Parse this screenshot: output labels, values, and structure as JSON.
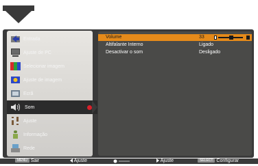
{
  "colors": {
    "osd_background": "#3a3a3a",
    "menu_panel": "#d9d7d3",
    "right_panel": "#4a4a48",
    "highlight": "#e58a1a",
    "selected_item": "#2b2b2b",
    "indicator": "#d8202a"
  },
  "menu": {
    "items": [
      {
        "label": "Entrada",
        "icon": "input-icon"
      },
      {
        "label": "Ajuste de PC",
        "icon": "pc-adjust-icon"
      },
      {
        "label": "Selecionar imagem",
        "icon": "image-select-icon"
      },
      {
        "label": "Ajuste de imagem",
        "icon": "image-adjust-icon"
      },
      {
        "label": "Ecrã",
        "icon": "screen-icon"
      },
      {
        "label": "Som",
        "icon": "sound-icon"
      },
      {
        "label": "Ajuste",
        "icon": "setting-icon"
      },
      {
        "label": "Informação",
        "icon": "information-icon"
      },
      {
        "label": "Rede",
        "icon": "network-icon"
      }
    ],
    "selected": "Som"
  },
  "sound_settings": {
    "volume": {
      "label": "Volume",
      "value": "33",
      "level": 33
    },
    "internal_speaker": {
      "label": "Altifalante Interno",
      "value": "Ligado"
    },
    "mute": {
      "label": "Desactivar o som",
      "value": "Desligado"
    }
  },
  "bottom_bar": {
    "exit_key": "MENU",
    "exit_label": "Sair",
    "adjust_left_label": "Ajuste",
    "adjust_right_label": "Ajuste",
    "configure_key": "SELECT",
    "configure_label": "Configurar"
  }
}
